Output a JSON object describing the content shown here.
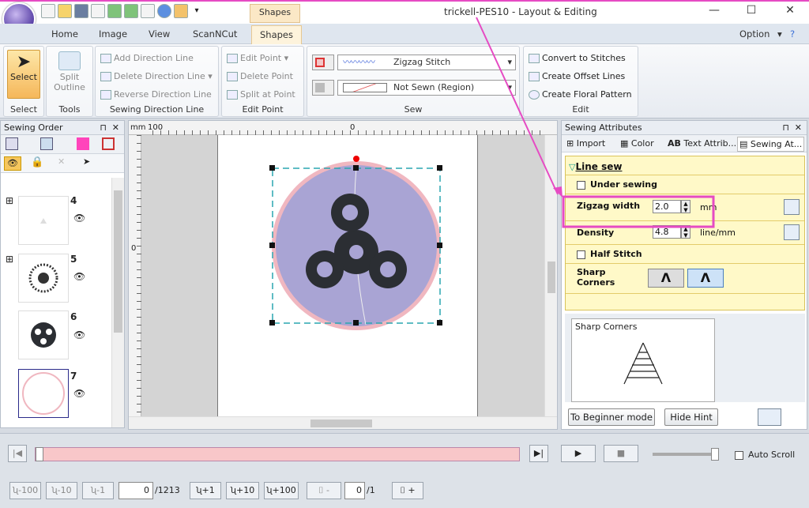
{
  "window": {
    "title": "trickell-PES10 - Layout & Editing",
    "contextual_tab": "Shapes",
    "minimize": "—",
    "maximize": "☐",
    "close": "✕"
  },
  "tabs": [
    "Home",
    "Image",
    "View",
    "ScanNCut",
    "Shapes"
  ],
  "option": {
    "label": "Option",
    "arrow": "▾",
    "help": "?"
  },
  "ribbon": {
    "select": {
      "label": "Select",
      "group": "Select"
    },
    "tools": {
      "label1": "Split",
      "label2": "Outline",
      "group": "Tools"
    },
    "sewing_direction": {
      "items": [
        "Add Direction Line",
        "Delete Direction Line",
        "Reverse Direction Line"
      ],
      "group": "Sewing Direction Line"
    },
    "edit_point": {
      "items": [
        "Edit Point",
        "Delete Point",
        "Split at Point"
      ],
      "group": "Edit Point"
    },
    "sew": {
      "stitch1": "Zigzag Stitch",
      "stitch2": "Not Sewn (Region)",
      "group": "Sew"
    },
    "edit": {
      "items": [
        "Convert to Stitches",
        "Create Offset Lines",
        "Create Floral Pattern"
      ],
      "group": "Edit"
    }
  },
  "sewing_order": {
    "title": "Sewing Order",
    "items": [
      {
        "num": "4"
      },
      {
        "num": "5"
      },
      {
        "num": "6"
      },
      {
        "num": "7"
      }
    ]
  },
  "ruler": {
    "unit": "mm",
    "left": "100",
    "center": "0",
    "vert": "0"
  },
  "attributes": {
    "title": "Sewing Attributes",
    "tabs": [
      "Import",
      "Color",
      "Text Attrib...",
      "Sewing At..."
    ],
    "section": "Line sew",
    "under_sewing": "Under sewing",
    "zigzag_label": "Zigzag width",
    "zigzag_value": "2.0",
    "zigzag_unit": "mm",
    "density_label": "Density",
    "density_value": "4.8",
    "density_unit": "line/mm",
    "half_stitch": "Half Stitch",
    "sharp_label1": "Sharp",
    "sharp_label2": "Corners",
    "hint_title": "Sharp Corners",
    "beginner_btn": "To Beginner mode",
    "hide_hint_btn": "Hide Hint"
  },
  "bottom": {
    "auto_scroll": "Auto Scroll",
    "stitch_current": "0",
    "stitch_total": "/1213",
    "color_current": "0",
    "color_total": "/1",
    "buttons_minus": [
      "-100",
      "-10",
      "-1"
    ],
    "buttons_plus": [
      "+1",
      "+10",
      "+100"
    ]
  },
  "colors": {
    "accent": "#e64bc3",
    "attr_bg": "#fff9c8",
    "design_fill": "#a9a4d4",
    "design_ring": "#f0b7c0",
    "dark": "#2b2e33"
  }
}
